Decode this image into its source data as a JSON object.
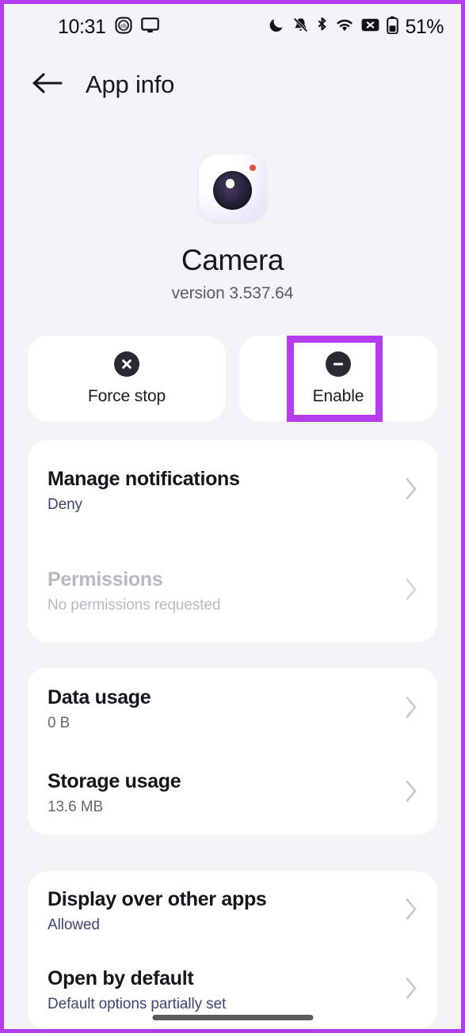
{
  "theme": {
    "background": "#f4f3f5",
    "card": "#ffffff",
    "accent_highlight": "#b43df0",
    "title_text": "#16161a",
    "sub_blue": "#3d4570",
    "sub_grey": "#6a6a6e",
    "disabled_text": "#b9b9bd",
    "chevron": "#c9c9ce",
    "icon_dark": "#2b2b2f"
  },
  "status_bar": {
    "time": "10:31",
    "left_icons": [
      "cb-badge-icon",
      "cast-screen-icon"
    ],
    "right_icons": [
      "do-not-disturb-moon-icon",
      "notifications-muted-icon",
      "bluetooth-icon",
      "wifi-icon",
      "no-sim-icon"
    ],
    "battery_percent": "51%"
  },
  "app_bar": {
    "back_icon": "arrow-left-icon",
    "title": "App info"
  },
  "app_header": {
    "icon": "camera-app-icon",
    "name": "Camera",
    "version": "version 3.537.64"
  },
  "actions": [
    {
      "label": "Force stop",
      "icon": "x-circle-icon",
      "highlighted": false
    },
    {
      "label": "Enable",
      "icon": "minus-circle-icon",
      "highlighted": true
    }
  ],
  "sections": [
    {
      "id": "notifications-permissions",
      "rows": [
        {
          "title": "Manage notifications",
          "subtitle": "Deny",
          "subtitle_style": "blue",
          "disabled": false
        },
        {
          "title": "Permissions",
          "subtitle": "No permissions requested",
          "subtitle_style": "grey",
          "disabled": true
        }
      ]
    },
    {
      "id": "usage",
      "rows": [
        {
          "title": "Data usage",
          "subtitle": "0 B",
          "subtitle_style": "grey",
          "disabled": false
        },
        {
          "title": "Storage usage",
          "subtitle": "13.6 MB",
          "subtitle_style": "grey",
          "disabled": false
        }
      ]
    },
    {
      "id": "display-defaults",
      "rows": [
        {
          "title": "Display over other apps",
          "subtitle": "Allowed",
          "subtitle_style": "blue",
          "disabled": false
        },
        {
          "title": "Open by default",
          "subtitle": "Default options partially set",
          "subtitle_style": "blue",
          "disabled": false
        }
      ]
    }
  ],
  "navigation": {
    "home_indicator": "home-indicator-bar"
  }
}
